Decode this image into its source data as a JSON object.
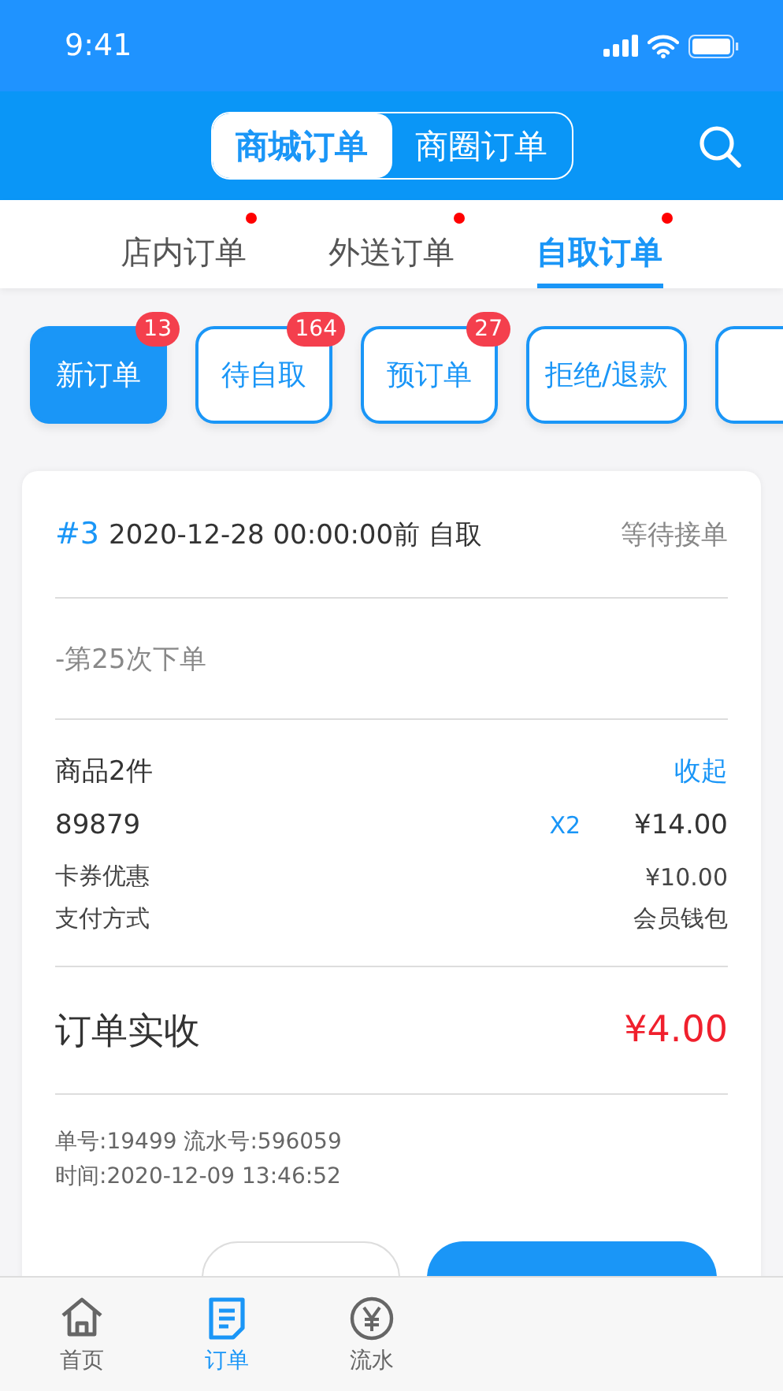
{
  "status_bar": {
    "time": "9:41"
  },
  "header": {
    "segments": [
      {
        "label": "商城订单",
        "selected": true
      },
      {
        "label": "商圈订单",
        "selected": false
      }
    ]
  },
  "order_types": [
    {
      "label": "店内订单",
      "selected": false,
      "dot": true
    },
    {
      "label": "外送订单",
      "selected": false,
      "dot": true
    },
    {
      "label": "自取订单",
      "selected": true,
      "dot": true
    }
  ],
  "filters": [
    {
      "label": "新订单",
      "selected": true,
      "badge": "13"
    },
    {
      "label": "待自取",
      "selected": false,
      "badge": "164"
    },
    {
      "label": "预订单",
      "selected": false,
      "badge": "27"
    },
    {
      "label": "拒绝/退款",
      "selected": false
    },
    {
      "selected": false
    }
  ],
  "order": {
    "number": "#3",
    "pickup": "2020-12-28 00:00:00前 自取",
    "status": "等待接单",
    "note": "-第25次下单",
    "items_summary": "商品2件",
    "collapse": "收起",
    "items": [
      {
        "name": "89879",
        "qty": "X2",
        "price": "¥14.00"
      }
    ],
    "details": [
      {
        "label": "卡券优惠",
        "value": "¥10.00"
      },
      {
        "label": "支付方式",
        "value": "会员钱包"
      }
    ],
    "total": {
      "label": "订单实收",
      "value": "¥4.00"
    },
    "meta": [
      "单号:19499 流水号:596059",
      "时间:2020-12-09 13:46:52"
    ],
    "actions": [
      {
        "kind": "secondary"
      },
      {
        "kind": "primary"
      }
    ]
  },
  "bottom_nav": [
    {
      "kind": "home",
      "label": "首页",
      "selected": false
    },
    {
      "kind": "orders",
      "label": "订单",
      "selected": true
    },
    {
      "kind": "ledger",
      "label": "流水",
      "selected": false
    }
  ]
}
